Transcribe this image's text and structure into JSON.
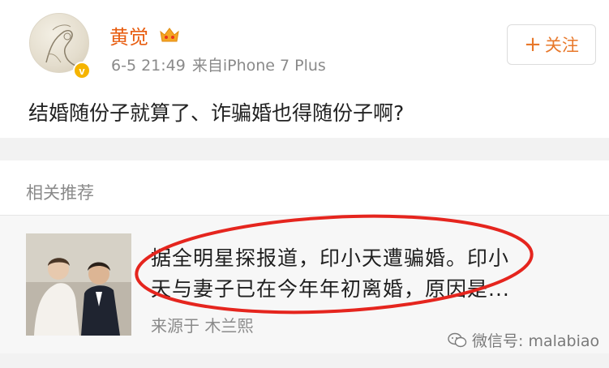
{
  "post": {
    "username": "黄觉",
    "time": "6-5 21:49",
    "source": "来自iPhone 7 Plus",
    "follow_label": "关注",
    "follow_plus": "+",
    "verified_badge": "v",
    "text": "结婚随份子就算了、诈骗婚也得随份子啊?"
  },
  "recommend": {
    "section_title": "相关推荐",
    "card": {
      "line1": "据全明星探报道，印小天遭骗婚。印小",
      "line2": "天与妻子已在今年年初离婚，原因是...",
      "source": "来源于 木兰熙"
    }
  },
  "watermark": {
    "text": "微信号: malabiao"
  },
  "colors": {
    "username": "#e85d10",
    "follow": "#e8782a",
    "oval": "#e5251e",
    "badge": "#f5b400"
  }
}
